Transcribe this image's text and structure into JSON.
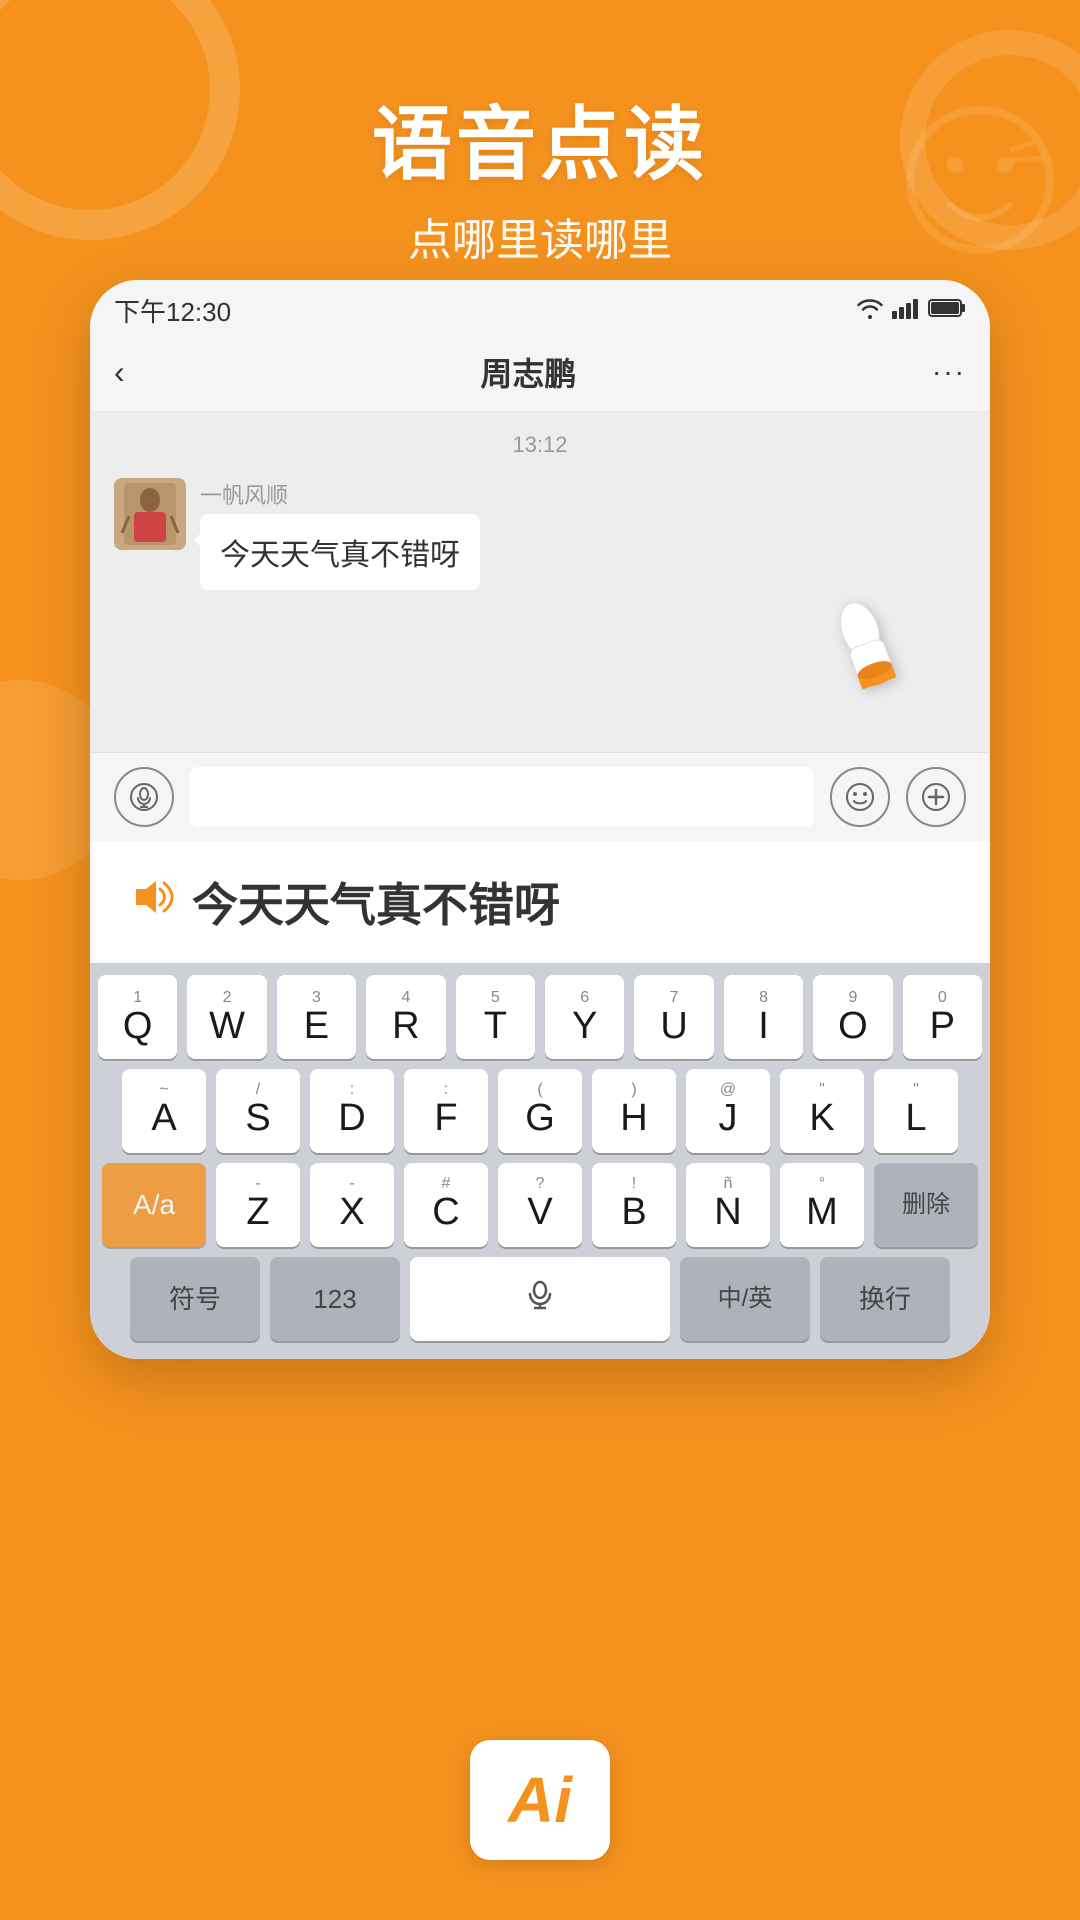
{
  "background_color": "#F5921E",
  "header": {
    "main_title": "语音点读",
    "sub_title": "点哪里读哪里"
  },
  "status_bar": {
    "time": "下午12:30",
    "wifi": "📶",
    "signal": "📶",
    "battery": "🔋"
  },
  "chat": {
    "title": "周志鹏",
    "back_label": "‹",
    "more_label": "···",
    "timestamp": "13:12",
    "sender_name": "一帆风顺",
    "message_text": "今天天气真不错呀"
  },
  "reading_popup": {
    "text": "今天天气真不错呀",
    "speaker_symbol": "🔊"
  },
  "keyboard": {
    "row1": [
      {
        "letter": "Q",
        "number": "1"
      },
      {
        "letter": "W",
        "number": "2"
      },
      {
        "letter": "E",
        "number": "3"
      },
      {
        "letter": "R",
        "number": "4"
      },
      {
        "letter": "T",
        "number": "5"
      },
      {
        "letter": "Y",
        "number": "6"
      },
      {
        "letter": "U",
        "number": "7"
      },
      {
        "letter": "I",
        "number": "8"
      },
      {
        "letter": "O",
        "number": "9"
      },
      {
        "letter": "P",
        "number": "0"
      }
    ],
    "row2": [
      {
        "letter": "A",
        "sub": "~"
      },
      {
        "letter": "S",
        "sub": "/"
      },
      {
        "letter": "D",
        "sub": ":"
      },
      {
        "letter": "F",
        "sub": ":"
      },
      {
        "letter": "G",
        "sub": "("
      },
      {
        "letter": "H",
        "sub": ")"
      },
      {
        "letter": "J",
        "sub": "@"
      },
      {
        "letter": "K",
        "sub": "\""
      },
      {
        "letter": "L",
        "sub": "\""
      }
    ],
    "row3": [
      {
        "letter": "A/a",
        "special": "shift"
      },
      {
        "letter": "Z",
        "sub": "-"
      },
      {
        "letter": "X",
        "sub": "-"
      },
      {
        "letter": "C",
        "sub": "#"
      },
      {
        "letter": "V",
        "sub": "?"
      },
      {
        "letter": "B",
        "sub": "!"
      },
      {
        "letter": "N",
        "sub": "ñ"
      },
      {
        "letter": "M",
        "sub": "°"
      },
      {
        "letter": "删除",
        "special": "delete"
      }
    ],
    "row4": [
      {
        "letter": "符号",
        "special": "func"
      },
      {
        "letter": "123",
        "special": "func"
      },
      {
        "letter": "🎤",
        "special": "space"
      },
      {
        "letter": "中/英",
        "special": "lang"
      },
      {
        "letter": "换行",
        "special": "return"
      }
    ]
  },
  "ai_badge": {
    "text": "Ai"
  }
}
